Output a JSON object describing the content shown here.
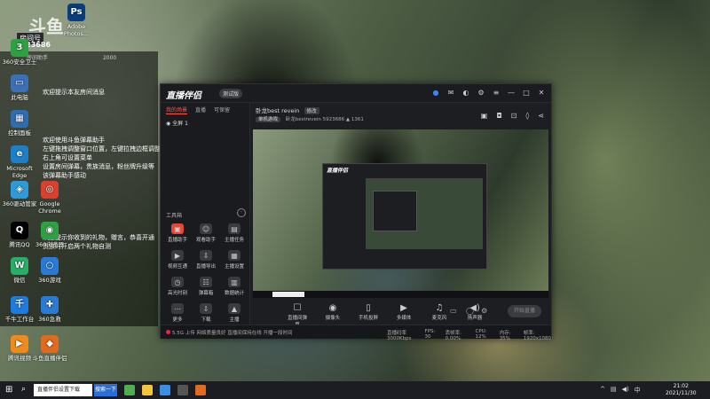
{
  "desktop": {
    "logo_text": "斗鱼",
    "room_label": "房间号",
    "room_number": "5923686",
    "icons": [
      {
        "label": "Adobe Photos...",
        "glyph": "Ps",
        "color": "#0a3d7a"
      },
      {
        "label": "360安全卫士",
        "glyph": "3",
        "color": "#2ea043"
      },
      {
        "label": "此电脑",
        "glyph": "▭",
        "color": "#3b6fb6"
      },
      {
        "label": "控制面板",
        "glyph": "▦",
        "color": "#2e6db0"
      },
      {
        "label": "Microsoft Edge",
        "glyph": "e",
        "color": "#1c7fc7"
      },
      {
        "label": "360驱动管家",
        "glyph": "◈",
        "color": "#2e9ad8"
      },
      {
        "label": "腾讯QQ",
        "glyph": "Q",
        "color": "#000"
      },
      {
        "label": "微信",
        "glyph": "W",
        "color": "#2aae67"
      },
      {
        "label": "千牛工作台",
        "glyph": "千",
        "color": "#1e7be0"
      },
      {
        "label": "腾讯视频",
        "glyph": "▶",
        "color": "#f08a1b"
      },
      {
        "label": "Google Chrome",
        "glyph": "◎",
        "color": "#d9402f"
      },
      {
        "label": "360浏览器",
        "glyph": "◉",
        "color": "#2ea043"
      },
      {
        "label": "360游戏",
        "glyph": "○",
        "color": "#2a7ad6"
      },
      {
        "label": "360急救",
        "glyph": "✚",
        "color": "#2a7ad6"
      },
      {
        "label": "斗鱼直播伴侣",
        "glyph": "◆",
        "color": "#e06a20"
      }
    ]
  },
  "overlay": {
    "header_left": "房间助手",
    "header_count": "2000",
    "lines": [
      "欢迎提示本友房间消息",
      "欢迎使用斗鱼弹幕助手",
      "左键拖拽调整窗口位置，左键拉拽边框调整大小",
      "右上角可设置菜单",
      "设置房间弹幕，贵族消息，粉丝牌升级等",
      "该弹幕助手感动",
      "欢迎提示你收到的礼物，赠言，恭喜开通",
      "贵族时开启两个礼物自测"
    ]
  },
  "app": {
    "title": "直播伴侣",
    "version": "测试版",
    "left_tabs": [
      "我的场景",
      "直播",
      "可保留"
    ],
    "scene": "全屏 1",
    "tools_header": "工具箱",
    "tools": [
      {
        "label": "直播助手",
        "glyph": "▣",
        "color": "#e8463b",
        "active": true
      },
      {
        "label": "观看助手",
        "glyph": "☺",
        "color": "#3a3b40"
      },
      {
        "label": "主播任务",
        "glyph": "▤",
        "color": "#3a3b40"
      },
      {
        "label": "视频互通",
        "glyph": "▶",
        "color": "#3a3b40"
      },
      {
        "label": "直播导出",
        "glyph": "⇩",
        "color": "#3a3b40"
      },
      {
        "label": "主播设置",
        "glyph": "▦",
        "color": "#3a3b40"
      },
      {
        "label": "高光时刻",
        "glyph": "◷",
        "color": "#3a3b40"
      },
      {
        "label": "弹幕箱",
        "glyph": "☷",
        "color": "#3a3b40"
      },
      {
        "label": "数据统计",
        "glyph": "▥",
        "color": "#3a3b40"
      },
      {
        "label": "更多",
        "glyph": "⋯",
        "color": "#3a3b40"
      },
      {
        "label": "下载",
        "glyph": "⇩",
        "color": "#3a3b40"
      },
      {
        "label": "主播",
        "glyph": "▲",
        "color": "#3a3b40"
      }
    ],
    "stream_title": "卧龙best revein",
    "stream_tag": "修改",
    "stream_category": "单机游戏",
    "stream_user": "卧龙bestrevein",
    "stream_room": "5923686",
    "stream_hot": "1361",
    "controls": [
      {
        "label": "直播间弹幕",
        "glyph": "☐"
      },
      {
        "label": "摄像头",
        "glyph": "◉"
      },
      {
        "label": "手机投屏",
        "glyph": "▯"
      },
      {
        "label": "多媒体",
        "glyph": "▶"
      },
      {
        "label": "麦克风",
        "glyph": "♫"
      },
      {
        "label": "扬声器",
        "glyph": "◀)"
      }
    ],
    "start_label": "开始直播",
    "status_left": "5.5G 上传  网络质量良好  直播间保持在线  开播一段时间",
    "status_right": [
      "直播码率 3000Kbps",
      "FPS: 30",
      "丢帧率: 0.00%",
      "CPU: 12%",
      "内存: 35%",
      "帧率: 1920x1080"
    ]
  },
  "taskbar": {
    "search_text": "直播伴侣设置下载",
    "search_button": "搜索一下",
    "time": "21:02",
    "date": "2021/11/30"
  }
}
